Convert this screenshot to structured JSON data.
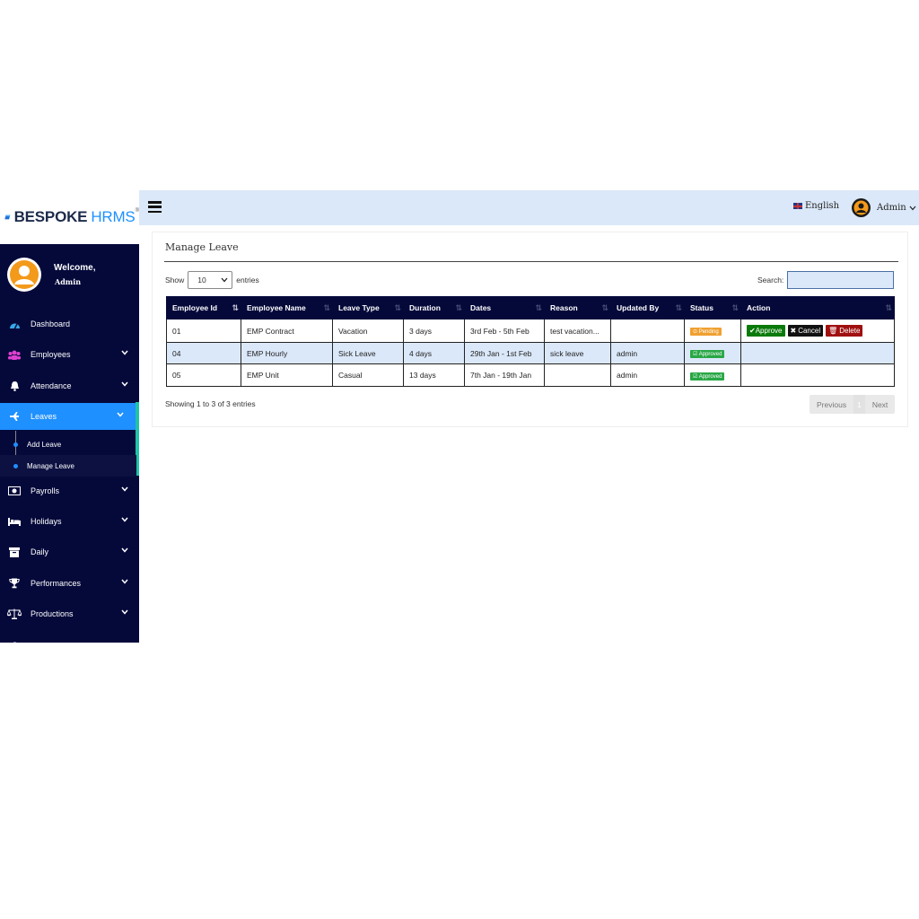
{
  "logo": {
    "brand_main": "BESPOKE",
    "brand_accent": "HRMS",
    "reg": "®"
  },
  "profile": {
    "welcome": "Welcome,",
    "name": "Admin"
  },
  "sidebar": {
    "items": [
      {
        "label": "Dashboard",
        "icon": "dashboard-icon",
        "has_chevron": false
      },
      {
        "label": "Employees",
        "icon": "users-icon",
        "has_chevron": true
      },
      {
        "label": "Attendance",
        "icon": "bell-icon",
        "has_chevron": true
      },
      {
        "label": "Leaves",
        "icon": "plane-icon",
        "has_chevron": true,
        "active": true
      },
      {
        "label": "Payrolls",
        "icon": "money-icon",
        "has_chevron": true
      },
      {
        "label": "Holidays",
        "icon": "bed-icon",
        "has_chevron": true
      },
      {
        "label": "Daily",
        "icon": "archive-icon",
        "has_chevron": true
      },
      {
        "label": "Performances",
        "icon": "trophy-icon",
        "has_chevron": true
      },
      {
        "label": "Productions",
        "icon": "scale-icon",
        "has_chevron": true
      }
    ],
    "subitems": [
      {
        "label": "Add Leave"
      },
      {
        "label": "Manage Leave",
        "current": true
      }
    ]
  },
  "topbar": {
    "language": "English",
    "user": "Admin"
  },
  "page": {
    "title": "Manage Leave",
    "show_label": "Show",
    "show_value": "10",
    "entries_label": "entries",
    "search_label": "Search:",
    "search_value": "",
    "showing_text": "Showing 1 to 3 of 3 entries",
    "pager": {
      "previous": "Previous",
      "page": "1",
      "next": "Next"
    }
  },
  "table": {
    "columns": [
      "Employee Id",
      "Employee Name",
      "Leave Type",
      "Duration",
      "Dates",
      "Reason",
      "Updated By",
      "Status",
      "Action"
    ],
    "rows": [
      {
        "id": "01",
        "name": "EMP Contract",
        "type": "Vacation",
        "duration": "3 days",
        "dates": "3rd Feb - 5th Feb",
        "reason": "test vacation...",
        "updated_by": "",
        "status": "Pending",
        "actions": [
          "Approve",
          "Cancel",
          "Delete"
        ]
      },
      {
        "id": "04",
        "name": "EMP Hourly",
        "type": "Sick Leave",
        "duration": "4 days",
        "dates": "29th Jan - 1st Feb",
        "reason": "sick leave",
        "updated_by": "admin",
        "status": "Approved",
        "actions": []
      },
      {
        "id": "05",
        "name": "EMP Unit",
        "type": "Casual",
        "duration": "13 days",
        "dates": "7th Jan - 19th Jan",
        "reason": "",
        "updated_by": "admin",
        "status": "Approved",
        "actions": []
      }
    ]
  },
  "colors": {
    "sidebar_bg": "#05093a",
    "accent": "#1e90ff",
    "topbar_bg": "#dbe8f9",
    "pending": "#f0a030",
    "approved": "#28a745"
  }
}
